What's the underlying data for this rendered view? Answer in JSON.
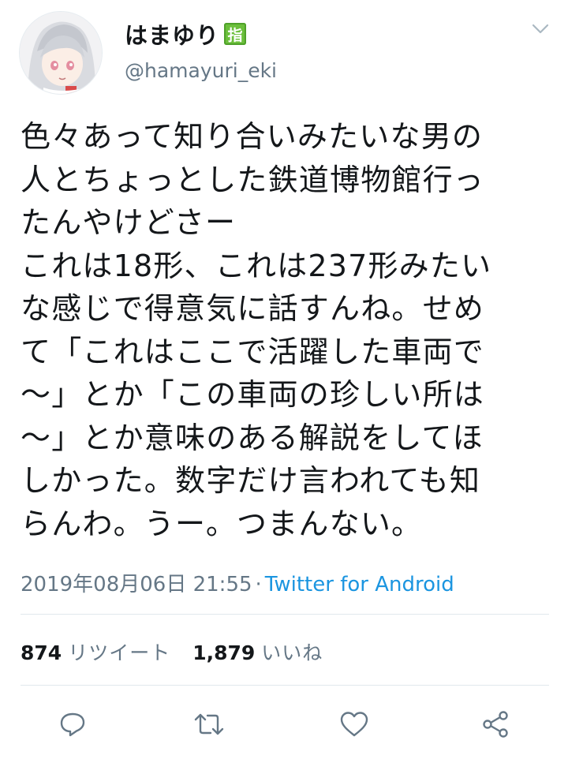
{
  "user": {
    "display_name": "はまゆり",
    "badge": "指",
    "handle": "@hamayuri_eki"
  },
  "tweet": {
    "text": "色々あって知り合いみたいな男の\n人とちょっとした鉄道博物館行っ\nたんやけどさー\nこれは18形、これは237形みたい\nな感じで得意気に話すんね。せめ\nて「これはここで活躍した車両で\n〜」とか「この車両の珍しい所は\n〜」とか意味のある解説をしてほ\nしかった。数字だけ言われても知\nらんわ。うー。つまんない。",
    "timestamp": "2019年08月06日 21:55",
    "separator": "·",
    "source": "Twitter for Android"
  },
  "stats": {
    "retweets_count": "874",
    "retweets_label": "リツイート",
    "likes_count": "1,879",
    "likes_label": "いいね"
  },
  "actions": [
    "reply-icon",
    "retweet-icon",
    "like-icon",
    "share-icon"
  ],
  "colors": {
    "text": "#14171a",
    "secondary": "#657786",
    "link": "#1b95e0",
    "badge": "#6bbf3b",
    "divider": "#e1e8ed"
  }
}
